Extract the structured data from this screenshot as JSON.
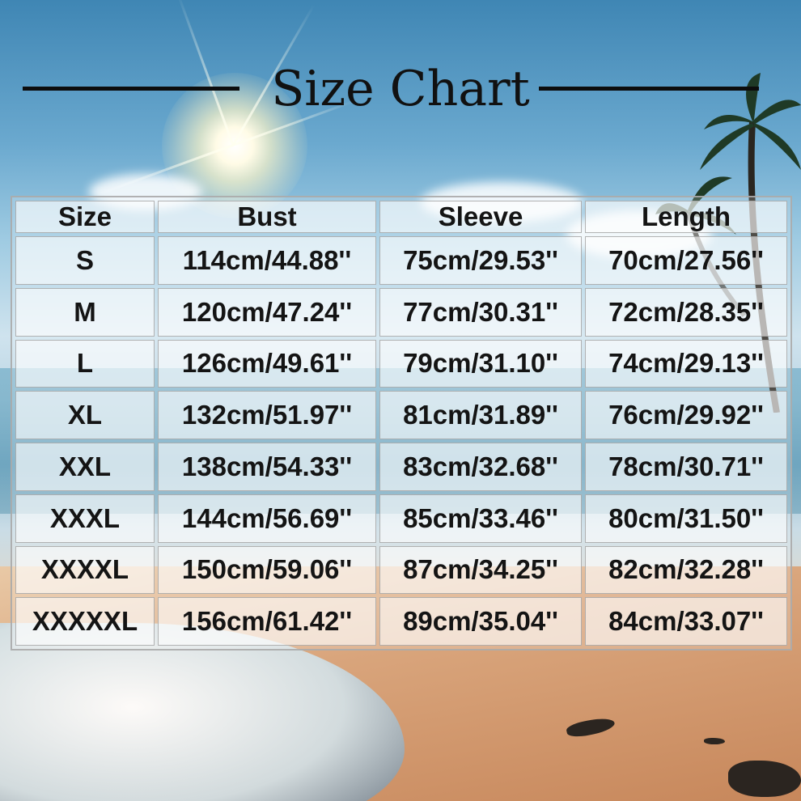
{
  "title": "Size Chart",
  "headers": [
    "Size",
    "Bust",
    "Sleeve",
    "Length"
  ],
  "rows": [
    [
      "S",
      "114cm/44.88''",
      "75cm/29.53''",
      "70cm/27.56''"
    ],
    [
      "M",
      "120cm/47.24''",
      "77cm/30.31''",
      "72cm/28.35''"
    ],
    [
      "L",
      "126cm/49.61''",
      "79cm/31.10''",
      "74cm/29.13''"
    ],
    [
      "XL",
      "132cm/51.97''",
      "81cm/31.89''",
      "76cm/29.92''"
    ],
    [
      "XXL",
      "138cm/54.33''",
      "83cm/32.68''",
      "78cm/30.71''"
    ],
    [
      "XXXL",
      "144cm/56.69''",
      "85cm/33.46''",
      "80cm/31.50''"
    ],
    [
      "XXXXL",
      "150cm/59.06''",
      "87cm/34.25''",
      "82cm/32.28''"
    ],
    [
      "XXXXXL",
      "156cm/61.42''",
      "89cm/35.04''",
      "84cm/33.07''"
    ]
  ]
}
